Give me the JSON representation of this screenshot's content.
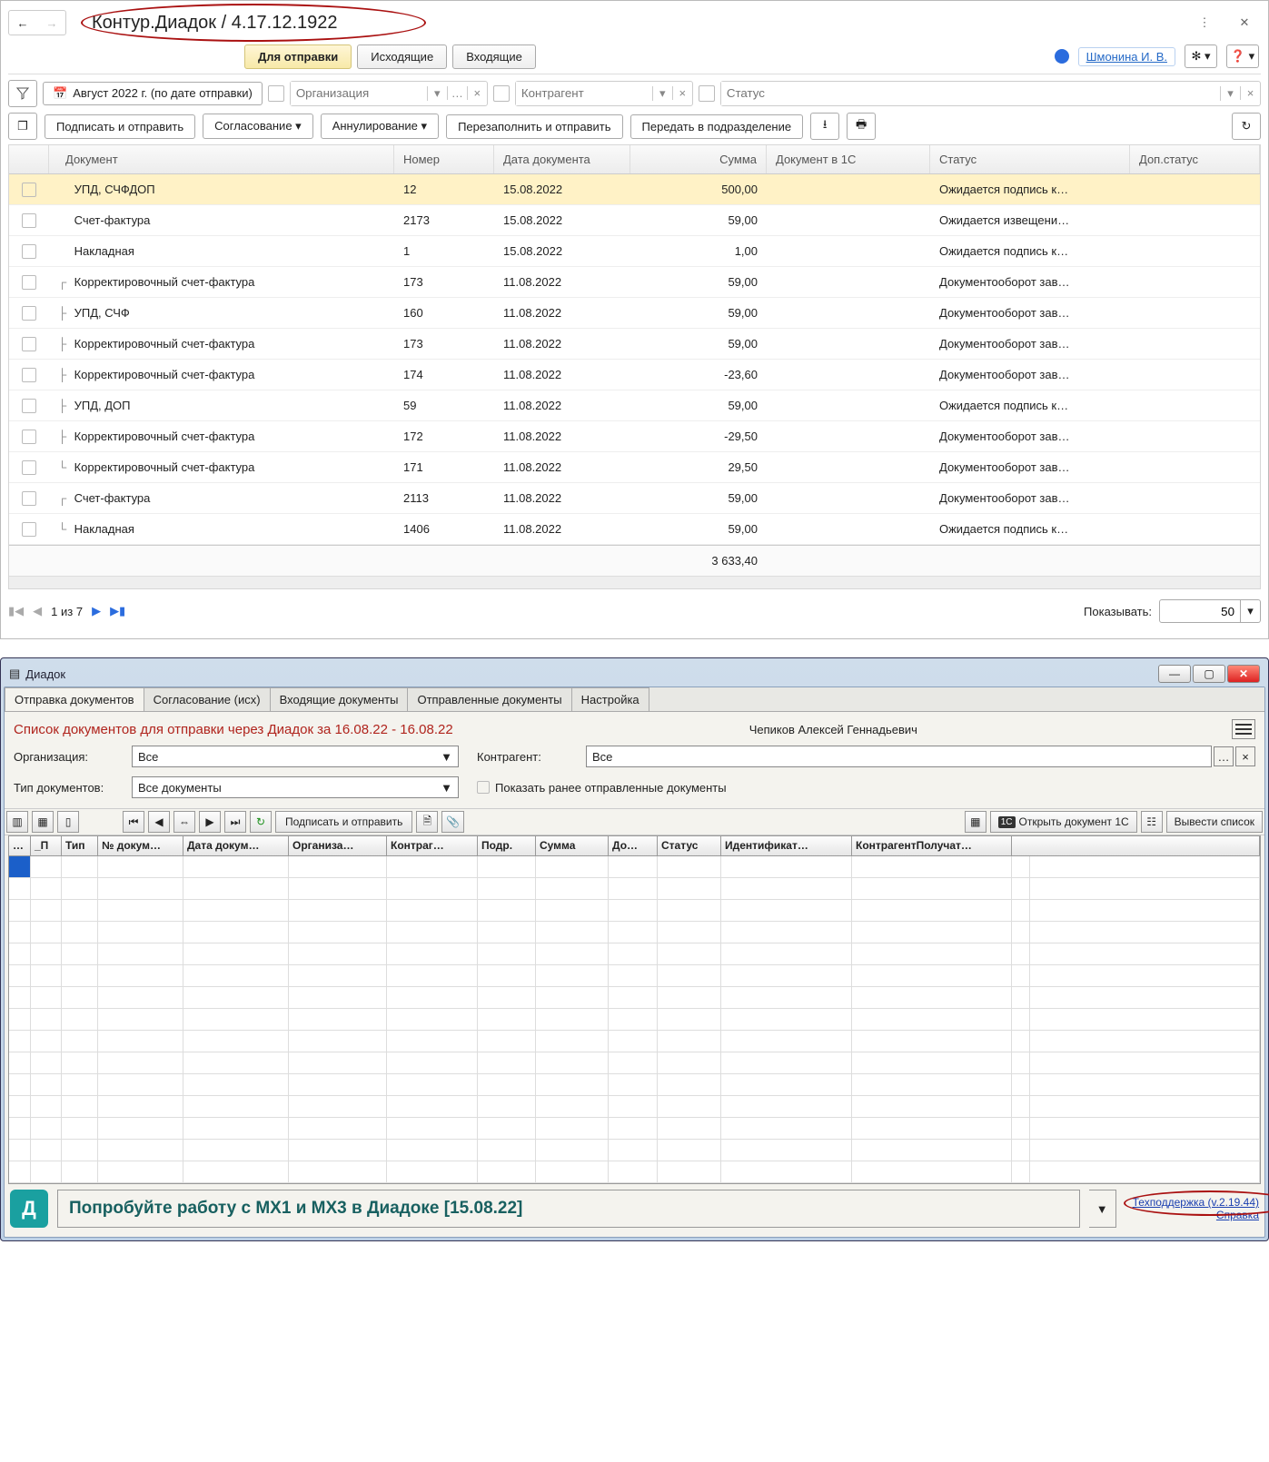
{
  "top": {
    "title": "Контур.Диадок / 4.17.12.1922",
    "tabs": {
      "send": "Для отправки",
      "out": "Исходящие",
      "in": "Входящие"
    },
    "user": "Шмонина И. В.",
    "date_filter": "Август 2022 г. (по дате отправки)",
    "org_placeholder": "Организация",
    "counter_placeholder": "Контрагент",
    "status_placeholder": "Статус",
    "toolbar": {
      "sign_send": "Подписать и отправить",
      "approve": "Согласование",
      "annul": "Аннулирование",
      "refill": "Перезаполнить и отправить",
      "to_dept": "Передать в подразделение"
    },
    "columns": {
      "doc": "Документ",
      "num": "Номер",
      "date": "Дата документа",
      "sum": "Сумма",
      "doc1c": "Документ в 1С",
      "status": "Статус",
      "extra": "Доп.статус"
    },
    "rows": [
      {
        "tree": "",
        "doc": "УПД, СЧФДОП",
        "num": "12",
        "date": "15.08.2022",
        "sum": "500,00",
        "status": "Ожидается подпись к…",
        "hl": true
      },
      {
        "tree": "",
        "doc": "Счет-фактура",
        "num": "2173",
        "date": "15.08.2022",
        "sum": "59,00",
        "status": "Ожидается извещени…"
      },
      {
        "tree": "",
        "doc": "Накладная",
        "num": "1",
        "date": "15.08.2022",
        "sum": "1,00",
        "status": "Ожидается подпись к…"
      },
      {
        "tree": "┌",
        "doc": "Корректировочный счет-фактура",
        "num": "173",
        "date": "11.08.2022",
        "sum": "59,00",
        "status": "Документооборот зав…"
      },
      {
        "tree": "├",
        "doc": "УПД, СЧФ",
        "num": "160",
        "date": "11.08.2022",
        "sum": "59,00",
        "status": "Документооборот зав…"
      },
      {
        "tree": "├",
        "doc": "Корректировочный счет-фактура",
        "num": "173",
        "date": "11.08.2022",
        "sum": "59,00",
        "status": "Документооборот зав…"
      },
      {
        "tree": "├",
        "doc": "Корректировочный счет-фактура",
        "num": "174",
        "date": "11.08.2022",
        "sum": "-23,60",
        "status": "Документооборот зав…"
      },
      {
        "tree": "├",
        "doc": "УПД, ДОП",
        "num": "59",
        "date": "11.08.2022",
        "sum": "59,00",
        "status": "Ожидается подпись к…"
      },
      {
        "tree": "├",
        "doc": "Корректировочный счет-фактура",
        "num": "172",
        "date": "11.08.2022",
        "sum": "-29,50",
        "status": "Документооборот зав…"
      },
      {
        "tree": "└",
        "doc": "Корректировочный счет-фактура",
        "num": "171",
        "date": "11.08.2022",
        "sum": "29,50",
        "status": "Документооборот зав…"
      },
      {
        "tree": "┌",
        "doc": "Счет-фактура",
        "num": "2113",
        "date": "11.08.2022",
        "sum": "59,00",
        "status": "Документооборот зав…"
      },
      {
        "tree": "└",
        "doc": "Накладная",
        "num": "1406",
        "date": "11.08.2022",
        "sum": "59,00",
        "status": "Ожидается подпись к…"
      }
    ],
    "total": "3 633,40",
    "pager": {
      "text": "1 из 7",
      "show_label": "Показывать:",
      "show_value": "50"
    }
  },
  "bottom": {
    "window_title": "Диадок",
    "tabs": [
      "Отправка документов",
      "Согласование (исх)",
      "Входящие документы",
      "Отправленные документы",
      "Настройка"
    ],
    "list_title": "Список документов для отправки через Диадок за 16.08.22 - 16.08.22",
    "user": "Чепиков Алексей Геннадьевич",
    "org_label": "Организация:",
    "org_value": "Все",
    "counter_label": "Контрагент:",
    "counter_value": "Все",
    "type_label": "Тип документов:",
    "type_value": "Все документы",
    "show_sent": "Показать ранее отправленные документы",
    "tb": {
      "sign": "Подписать и отправить",
      "open1c": "Открыть документ 1С",
      "list_out": "Вывести список"
    },
    "cols": [
      "…",
      "_П",
      "Тип",
      "№ докум…",
      "Дата докум…",
      "Организа…",
      "Контраг…",
      "Подр.",
      "Сумма",
      "До…",
      "Статус",
      "Идентификат…",
      "КонтрагентПолучат…"
    ],
    "banner": "Попробуйте работу с MX1 и MX3 в Диадоке   [15.08.22]",
    "support": "Техподдержка (v.2.19.44)",
    "help": "Справка"
  }
}
